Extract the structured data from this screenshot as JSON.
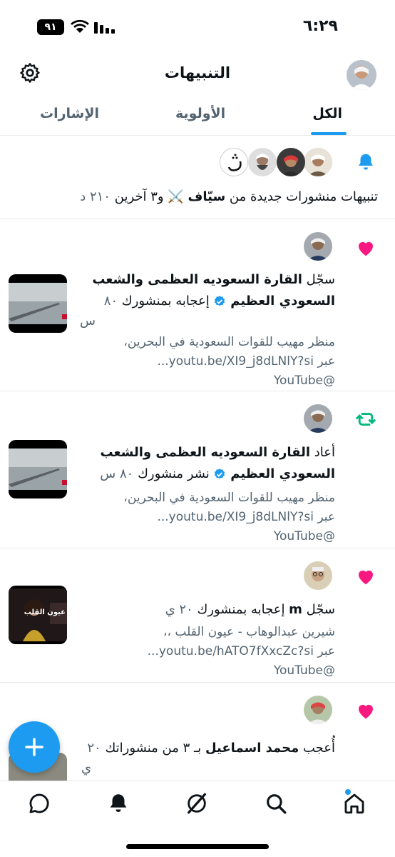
{
  "status": {
    "time": "٦:٢٩",
    "battery": "٩١"
  },
  "header": {
    "title": "التنبيهات",
    "settings_icon": "gear-icon"
  },
  "tabs": [
    {
      "label": "الكل",
      "active": true
    },
    {
      "label": "الأولوية",
      "active": false
    },
    {
      "label": "الإشارات",
      "active": false
    }
  ],
  "notifications": [
    {
      "type_icon": "bell-icon",
      "text_prefix": "تنبيهات منشورات جديدة من ",
      "actor": "سيّاف",
      "text_suffix": " ⚔️ و٣ آخرين",
      "time": "٢١٠ د"
    },
    {
      "type_icon": "heart-icon",
      "verb": "سجّل ",
      "actor_line1": "القارة السعوديه العظمى والشعب",
      "actor_line2": "السعودي العظيم",
      "action": " إعجابه بمنشورك",
      "time": "٨٠",
      "time_unit": "س",
      "preview_line1": "منظر مهيب للقوات السعودية في البحرين،",
      "preview_line2": "عبر youtu.be/XI9_j8dLNlY?si...",
      "preview_line3": "@YouTube"
    },
    {
      "type_icon": "retweet-icon",
      "verb": "أعاد ",
      "actor_line1": "القارة السعوديه العظمى والشعب",
      "actor_line2": "السعودي العظيم",
      "action": " نشر منشورك",
      "time": "٨٠ س",
      "preview_line1": "منظر مهيب للقوات السعودية في البحرين،",
      "preview_line2": "عبر youtu.be/XI9_j8dLNlY?si...",
      "preview_line3": "@YouTube"
    },
    {
      "type_icon": "heart-icon",
      "verb": "سجّل ",
      "actor": "m",
      "action": " إعجابه بمنشورك",
      "time": "٢٠ ي",
      "preview_line1": "شيرين عبدالوهاب - عيون القلب ،،",
      "preview_line2": "عبر youtu.be/hATO7fXxcZc?si...",
      "preview_line3": "@YouTube",
      "thumb_caption": "عيون القلب"
    },
    {
      "type_icon": "heart-icon",
      "verb": "أُعجب ",
      "actor": "محمد اسماعيل",
      "action": " بـ ٣ من منشوراتك",
      "time": "٢٠",
      "time_unit": "ي"
    }
  ],
  "colors": {
    "accent": "#1d9bf0",
    "like": "#f91880",
    "retweet": "#00ba7c"
  },
  "nav": [
    "home-icon",
    "search-icon",
    "grok-icon",
    "notifications-icon",
    "messages-icon"
  ]
}
